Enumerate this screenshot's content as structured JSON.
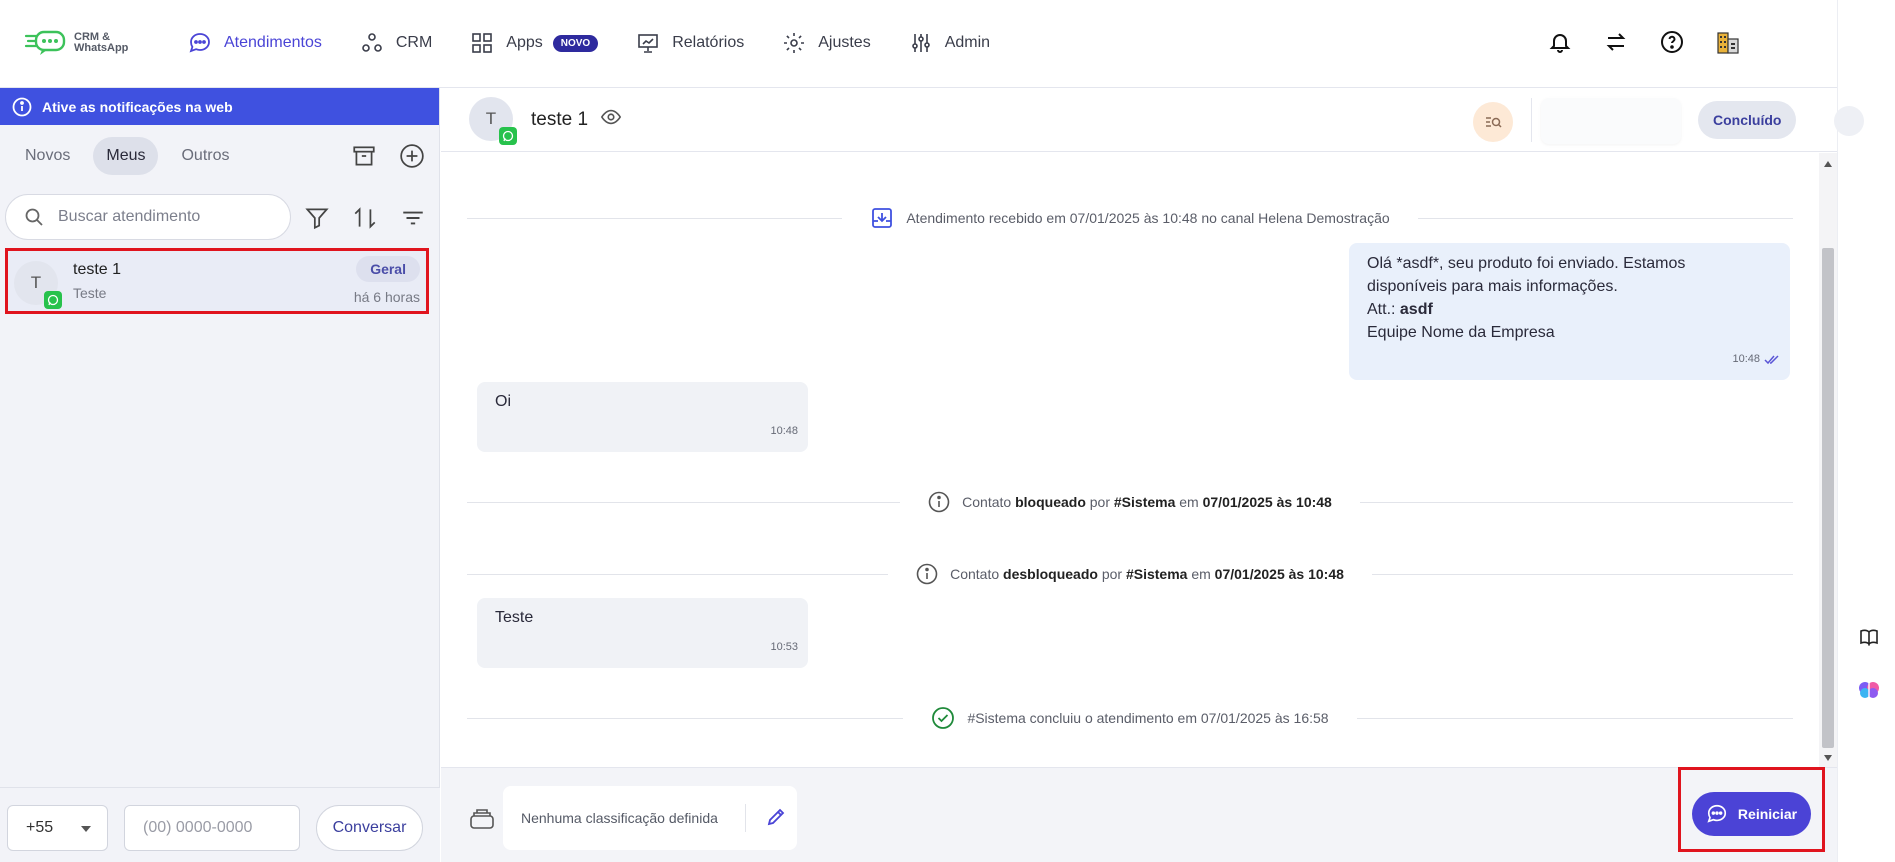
{
  "app": {
    "logo_text": "CRM & WhatsApp",
    "accent": "#4a44d6"
  },
  "nav": {
    "items": [
      {
        "label": "Atendimentos",
        "icon": "chat-bubble-icon",
        "active": true
      },
      {
        "label": "CRM",
        "icon": "nodes-icon"
      },
      {
        "label": "Apps",
        "icon": "grid-icon",
        "badge": "NOVO"
      },
      {
        "label": "Relatórios",
        "icon": "presentation-chart-icon"
      },
      {
        "label": "Ajustes",
        "icon": "gear-icon"
      },
      {
        "label": "Admin",
        "icon": "sliders-icon"
      }
    ]
  },
  "top_actions": [
    "bell-icon",
    "swap-arrows-icon",
    "help-icon",
    "building-icon"
  ],
  "left": {
    "notification_bar": "Ative as notificações na web",
    "tabs": [
      "Novos",
      "Meus",
      "Outros"
    ],
    "active_tab": "Meus",
    "search_placeholder": "Buscar atendimento",
    "conversation": {
      "avatar_letter": "T",
      "name": "teste 1",
      "preview": "Teste",
      "tag": "Geral",
      "time": "há 6 horas"
    },
    "footer": {
      "ddi": "+55",
      "phone_placeholder": "(00) 0000-0000",
      "button": "Conversar"
    }
  },
  "chat": {
    "header": {
      "avatar_letter": "T",
      "title": "teste 1",
      "status_button": "Concluído"
    },
    "events": {
      "received": "Atendimento recebido em 07/01/2025 às 10:48 no canal Helena Demostração",
      "blocked": {
        "pre": "Contato ",
        "b1": "bloqueado",
        "mid": " por ",
        "b2": "#Sistema",
        "mid2": " em ",
        "b3": "07/01/2025 às 10:48"
      },
      "unblocked": {
        "pre": "Contato ",
        "b1": "desbloqueado",
        "mid": " por ",
        "b2": "#Sistema",
        "mid2": " em ",
        "b3": "07/01/2025 às 10:48"
      },
      "concluded": "#Sistema concluiu o atendimento em 07/01/2025 às 16:58"
    },
    "messages": {
      "outgoing": {
        "line1": "Olá *asdf*, seu produto foi enviado. Estamos",
        "line2": "disponíveis para mais informações.",
        "line3_prefix": "Att.: ",
        "line3_bold": "asdf",
        "line4": "Equipe Nome da Empresa",
        "time": "10:48"
      },
      "in1": {
        "text": "Oi",
        "time": "10:48"
      },
      "in2": {
        "text": "Teste",
        "time": "10:53"
      }
    },
    "footer": {
      "classification": "Nenhuma classificação definida",
      "restart_button": "Reiniciar"
    }
  }
}
